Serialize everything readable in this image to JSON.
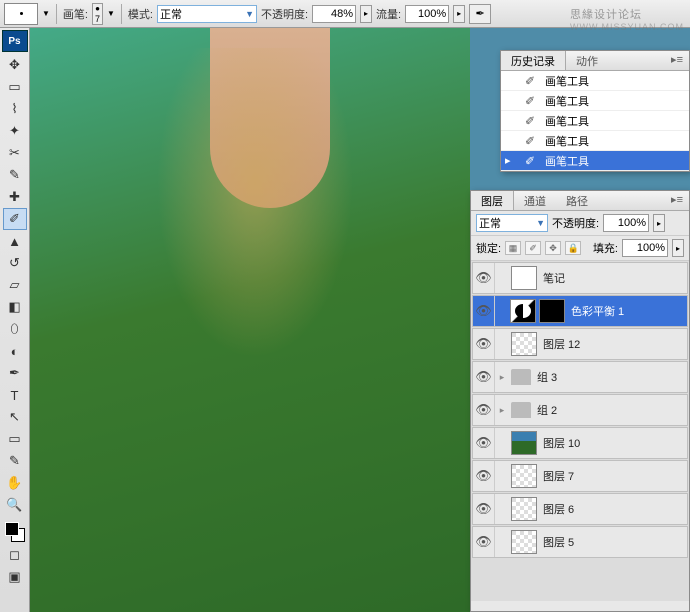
{
  "options": {
    "brush_label": "画笔:",
    "brush_size": "7",
    "mode_label": "模式:",
    "mode_value": "正常",
    "opacity_label": "不透明度:",
    "opacity_value": "48%",
    "flow_label": "流量:",
    "flow_value": "100%"
  },
  "watermark": {
    "main": "思緣设计论坛",
    "sub": "WWW.MISSYUAN.COM"
  },
  "history_panel": {
    "tab_history": "历史记录",
    "tab_actions": "动作",
    "items": [
      {
        "label": "画笔工具"
      },
      {
        "label": "画笔工具"
      },
      {
        "label": "画笔工具"
      },
      {
        "label": "画笔工具"
      },
      {
        "label": "画笔工具"
      }
    ]
  },
  "layers_panel": {
    "tab_layers": "图层",
    "tab_channels": "通道",
    "tab_paths": "路径",
    "blend_mode": "正常",
    "opacity_label": "不透明度:",
    "opacity_value": "100%",
    "lock_label": "锁定:",
    "fill_label": "填充:",
    "fill_value": "100%",
    "layers": [
      {
        "name": "笔记",
        "type": "normal",
        "thumb": "solid"
      },
      {
        "name": "色彩平衡 1",
        "type": "adjustment",
        "selected": true
      },
      {
        "name": "图层 12",
        "type": "normal",
        "thumb": "checker"
      },
      {
        "name": "组 3",
        "type": "group"
      },
      {
        "name": "组 2",
        "type": "group"
      },
      {
        "name": "图层 10",
        "type": "normal",
        "thumb": "img"
      },
      {
        "name": "图层 7",
        "type": "normal",
        "thumb": "checker"
      },
      {
        "name": "图层 6",
        "type": "normal",
        "thumb": "checker"
      },
      {
        "name": "图层 5",
        "type": "normal",
        "thumb": "checker"
      }
    ]
  },
  "toolbox": {
    "ps": "Ps"
  }
}
